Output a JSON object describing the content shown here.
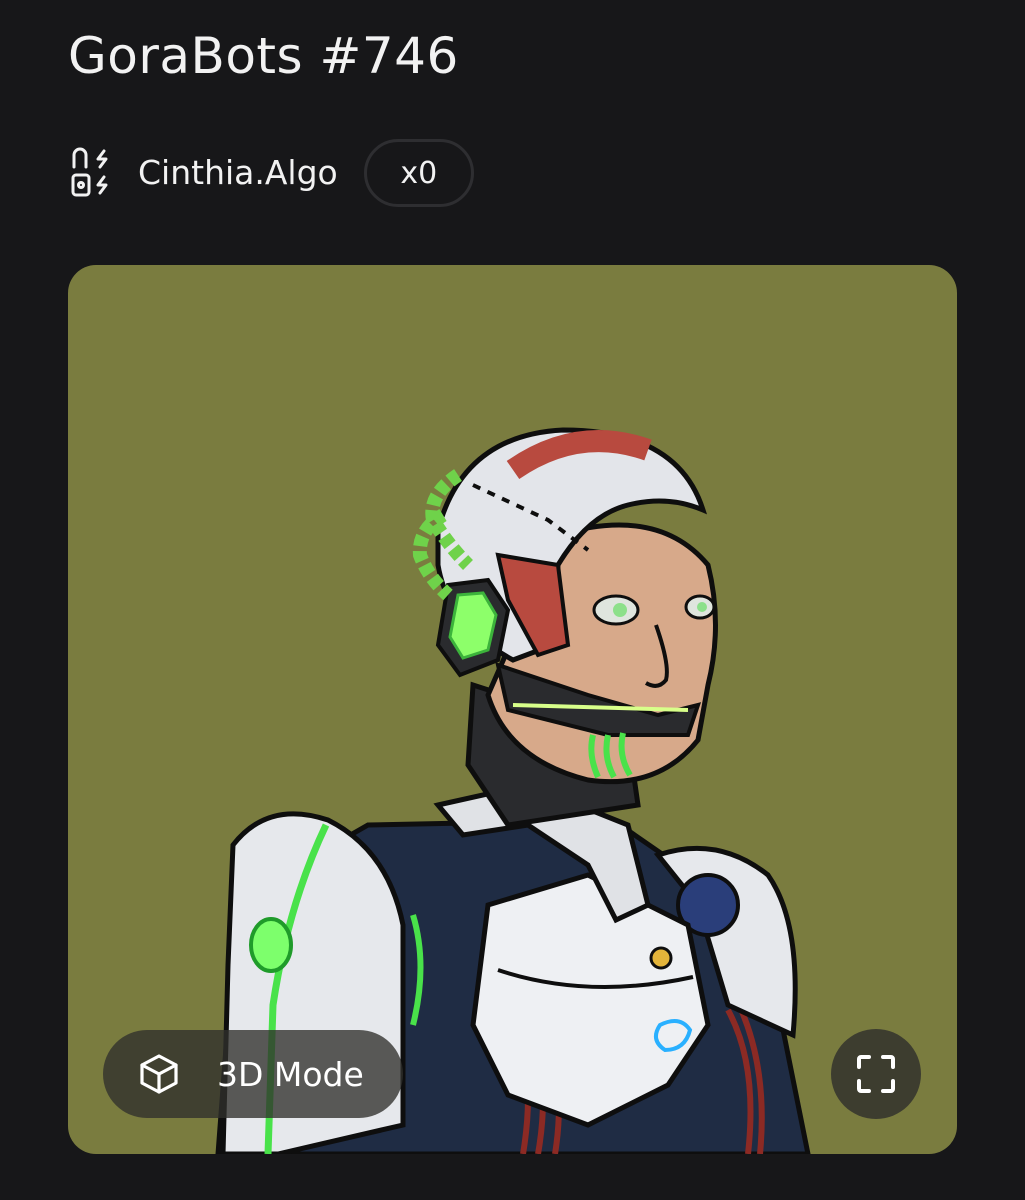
{
  "nft": {
    "title": "GoraBots #746",
    "owner_name": "Cinthia.Algo",
    "count_badge": "x0",
    "card_background": "#7a7c3f"
  },
  "controls": {
    "mode_label": "3D Mode"
  },
  "icons": {
    "owner": "owner-lock-arrows-icon",
    "mode": "cube-icon",
    "fullscreen": "fullscreen-corners-icon"
  }
}
